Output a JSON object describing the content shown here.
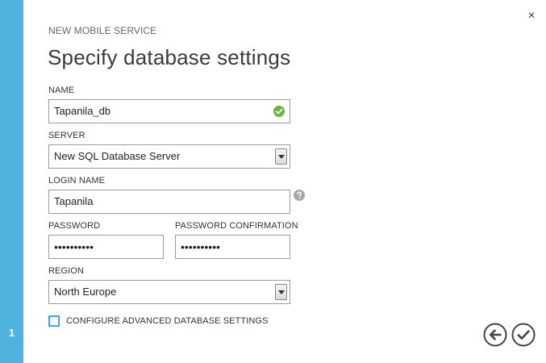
{
  "wizard": {
    "label": "NEW MOBILE SERVICE",
    "title": "Specify database settings",
    "step": "1",
    "close_symbol": "×"
  },
  "form": {
    "name": {
      "label": "NAME",
      "value": "Tapanila_db",
      "valid_icon": "check-circle-icon"
    },
    "server": {
      "label": "SERVER",
      "selected": "New SQL Database Server"
    },
    "login_name": {
      "label": "LOGIN NAME",
      "value": "Tapanila",
      "help_icon": "question-circle-icon"
    },
    "password": {
      "label": "PASSWORD",
      "value": "••••••••••"
    },
    "password_confirmation": {
      "label": "PASSWORD CONFIRMATION",
      "value": "••••••••••"
    },
    "region": {
      "label": "REGION",
      "selected": "North Europe"
    },
    "advanced": {
      "label": "CONFIGURE ADVANCED DATABASE SETTINGS",
      "checked": false
    }
  },
  "footer": {
    "back_icon": "arrow-left-circle-icon",
    "finish_icon": "check-circle-outline-icon"
  },
  "colors": {
    "sidebar": "#4fb3df",
    "valid": "#6db33f",
    "checkbox_border": "#3ea8d8",
    "help": "#a8a8a8"
  }
}
